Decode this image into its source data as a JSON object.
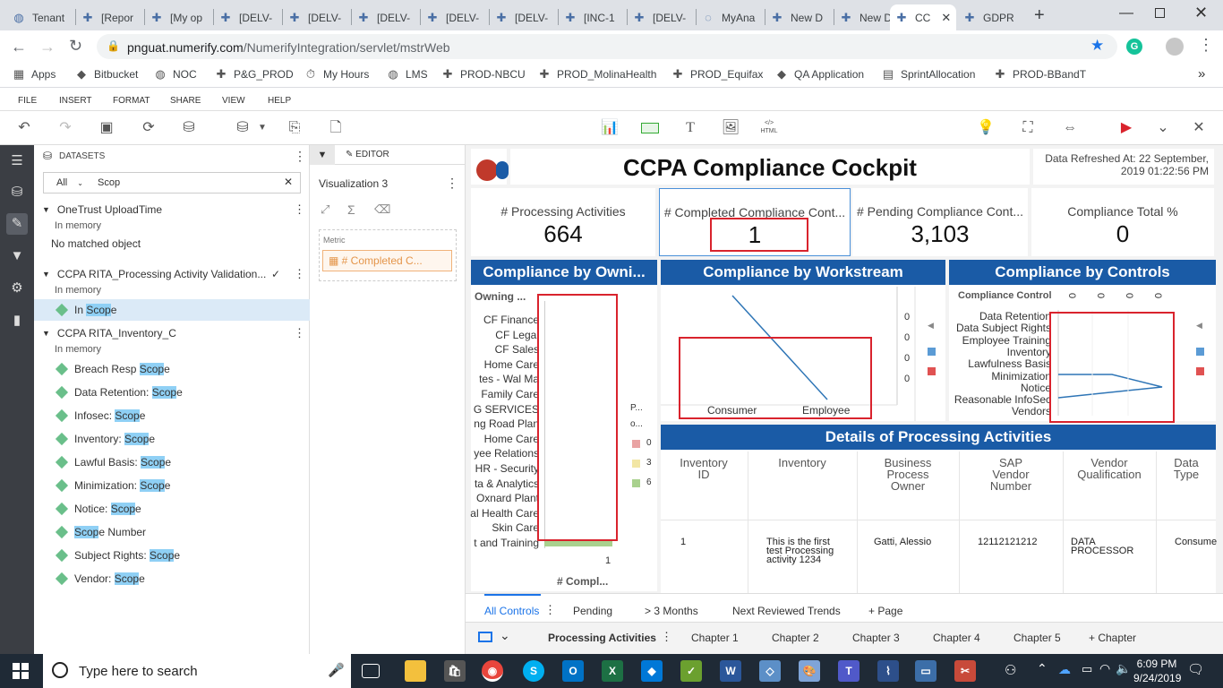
{
  "browser": {
    "tabs": [
      {
        "label": "Tenant",
        "icon": "globe-icon"
      },
      {
        "label": "[Repor",
        "icon": "tableau-icon"
      },
      {
        "label": "[My op",
        "icon": "tableau-icon"
      },
      {
        "label": "[DELV-",
        "icon": "tableau-icon"
      },
      {
        "label": "[DELV-",
        "icon": "tableau-icon"
      },
      {
        "label": "[DELV-",
        "icon": "tableau-icon"
      },
      {
        "label": "[DELV-",
        "icon": "tableau-icon"
      },
      {
        "label": "[DELV-",
        "icon": "tableau-icon"
      },
      {
        "label": "[INC-1",
        "icon": "tableau-icon"
      },
      {
        "label": "[DELV-",
        "icon": "tableau-icon"
      },
      {
        "label": "MyAna",
        "icon": "loading-icon"
      },
      {
        "label": "New D",
        "icon": "tableau-icon"
      },
      {
        "label": "New D",
        "icon": "tableau-icon"
      },
      {
        "label": "CC",
        "icon": "tableau-icon"
      },
      {
        "label": "GDPR",
        "icon": "tableau-icon"
      }
    ],
    "url_host": "pnguat.numerify.com",
    "url_path": "/NumerifyIntegration/servlet/mstrWeb",
    "bookmarks": [
      {
        "label": "Apps",
        "icon": "apps-grid-icon"
      },
      {
        "label": "Bitbucket",
        "icon": "bitbucket-icon"
      },
      {
        "label": "NOC",
        "icon": "globe-icon"
      },
      {
        "label": "P&G_PROD",
        "icon": "tableau-icon"
      },
      {
        "label": "My Hours",
        "icon": "stopwatch-icon"
      },
      {
        "label": "LMS",
        "icon": "globe-icon"
      },
      {
        "label": "PROD-NBCU",
        "icon": "tableau-icon"
      },
      {
        "label": "PROD_MolinaHealth",
        "icon": "tableau-icon"
      },
      {
        "label": "PROD_Equifax",
        "icon": "tableau-icon"
      },
      {
        "label": "QA Application",
        "icon": "bitbucket-icon"
      },
      {
        "label": "SprintAllocation",
        "icon": "sheets-icon"
      },
      {
        "label": "PROD-BBandT",
        "icon": "tableau-icon"
      }
    ],
    "colors": {
      "accent": "#1a73e8",
      "tabstrip": "#dee1e6"
    }
  },
  "app": {
    "menu": [
      "FILE",
      "INSERT",
      "FORMAT",
      "SHARE",
      "VIEW",
      "HELP"
    ]
  },
  "datasets": {
    "title": "DATASETS",
    "filter_value": "All",
    "search_value": "Scop",
    "groups": [
      {
        "name": "OneTrust UploadTime",
        "source": "In memory",
        "empty": "No matched object"
      },
      {
        "name": "CCPA RITA_Processing Activity Validation...",
        "source": "In memory",
        "items": [
          {
            "pre": "In ",
            "hl": "Scop",
            "post": "e"
          }
        ]
      },
      {
        "name": "CCPA RITA_Inventory_C",
        "source": "In memory",
        "items": [
          {
            "pre": "Breach Resp ",
            "hl": "Scop",
            "post": "e"
          },
          {
            "pre": "Data Retention: ",
            "hl": "Scop",
            "post": "e"
          },
          {
            "pre": "Infosec: ",
            "hl": "Scop",
            "post": "e"
          },
          {
            "pre": "Inventory: ",
            "hl": "Scop",
            "post": "e"
          },
          {
            "pre": "Lawful Basis: ",
            "hl": "Scop",
            "post": "e"
          },
          {
            "pre": "Minimization: ",
            "hl": "Scop",
            "post": "e"
          },
          {
            "pre": "Notice: ",
            "hl": "Scop",
            "post": "e"
          },
          {
            "pre": "",
            "hl": "Scop",
            "post": "e Number"
          },
          {
            "pre": "Subject Rights: ",
            "hl": "Scop",
            "post": "e"
          },
          {
            "pre": "Vendor: ",
            "hl": "Scop",
            "post": "e"
          }
        ]
      }
    ]
  },
  "editor": {
    "tab_label": "EDITOR",
    "viz_name": "Visualization 3",
    "metric_label": "Metric",
    "metric_value": "# Completed C..."
  },
  "dashboard": {
    "title": "CCPA Compliance Cockpit",
    "refresh_text_1": "Data Refreshed At: 22 September,",
    "refresh_text_2": "2019 01:22:56 PM",
    "kpis": [
      {
        "label": "# Processing Activities",
        "value": "664"
      },
      {
        "label": "# Completed Compliance Cont...",
        "value": "1"
      },
      {
        "label": "# Pending Compliance Cont...",
        "value": "3,103"
      },
      {
        "label": "Compliance Total %",
        "value": "0"
      }
    ],
    "panel1": {
      "title": "Compliance by Owni...",
      "col_header": "Owning ...",
      "rows": [
        "CF Finance",
        "CF Legal",
        "CF Sales",
        "Home Care",
        "tes - Wal Ma",
        "Family Care",
        "G SERVICES",
        "ng Road Plan",
        "Home Care",
        "yee Relations",
        "HR - Security",
        "ta & Analytics",
        "Oxnard Plant",
        "al Health Care",
        "Skin Care",
        "t and Training"
      ],
      "x_tick": "1",
      "x_label": "# Compl...",
      "legend_title_1": "P...",
      "legend_title_2": "o...",
      "legend": [
        {
          "label": "0",
          "color": "#e9a3a3"
        },
        {
          "label": "3",
          "color": "#f2e6a4"
        },
        {
          "label": "6",
          "color": "#a9d18e"
        }
      ]
    },
    "panel2": {
      "title": "Compliance by Workstream",
      "x_labels": [
        "Consumer",
        "Employee"
      ],
      "y_ticks": [
        "0",
        "0",
        "0",
        "0"
      ]
    },
    "panel3": {
      "title": "Compliance by Controls",
      "col_header": "Compliance Control",
      "top_ticks": [
        "0",
        "0",
        "0",
        "0"
      ],
      "rows": [
        "Data Retention",
        "Data Subject Rights",
        "Employee Training",
        "Inventory",
        "Lawfulness Basis",
        "Minimization",
        "Notice",
        "Reasonable InfoSec",
        "Vendors"
      ]
    },
    "details": {
      "title": "Details of Processing Activities",
      "headers": [
        [
          "Inventory",
          "ID"
        ],
        [
          "Inventory",
          ""
        ],
        [
          "Business",
          "Process",
          "Owner"
        ],
        [
          "SAP",
          "Vendor",
          "Number"
        ],
        [
          "Vendor",
          "Qualification"
        ],
        [
          "Data",
          "Type"
        ]
      ],
      "row": {
        "id": "1",
        "inventory": [
          "This is the first",
          "test Processing",
          "activity 1234"
        ],
        "owner": "Gatti, Alessio",
        "sap": "12112121212",
        "qualification": [
          "DATA",
          "PROCESSOR"
        ],
        "type": "Consume"
      }
    },
    "series_colors": {
      "a": "#5b9bd5",
      "b": "#e05252",
      "line": "#2e75b6"
    }
  },
  "page_tabs": [
    "All Controls",
    "Pending",
    "> 3 Months",
    "Next Reviewed Trends",
    "+ Page"
  ],
  "chapter_tabs": [
    "Processing Activities",
    "Chapter 1",
    "Chapter 2",
    "Chapter 3",
    "Chapter 4",
    "Chapter 5",
    "+ Chapter"
  ],
  "taskbar": {
    "search_placeholder": "Type here to search",
    "time": "6:09 PM",
    "date": "9/24/2019"
  }
}
